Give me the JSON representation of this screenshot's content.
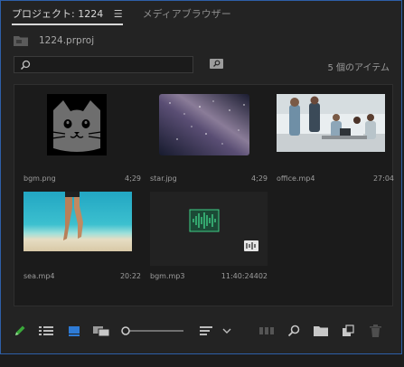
{
  "tabs": [
    {
      "label": "プロジェクト: 1224"
    },
    {
      "label": "メディアブラウザー"
    }
  ],
  "tab_menu_icon": "hamburger-menu-icon",
  "project": {
    "file_name": "1224.prproj",
    "icon": "project-folder-icon"
  },
  "search": {
    "value": "",
    "placeholder": ""
  },
  "item_count": "5 個のアイテム",
  "items": [
    {
      "name": "bgm.png",
      "duration": "4;29",
      "thumb": "cat-face-icon"
    },
    {
      "name": "star.jpg",
      "duration": "4;29",
      "thumb": "starry-sky-image"
    },
    {
      "name": "office.mp4",
      "duration": "27:04",
      "thumb": "office-meeting-image"
    },
    {
      "name": "sea.mp4",
      "duration": "20:22",
      "thumb": "beach-sea-image"
    },
    {
      "name": "bgm.mp3",
      "duration": "11:40:24402",
      "thumb": "audio-waveform-icon"
    }
  ],
  "colors": {
    "accent": "#2e5fa8",
    "panel_bg": "#232323",
    "grid_bg": "#1b1b1b",
    "pencil": "#3aa83a",
    "audio_thumb": "#3fcf86"
  },
  "toolbar_icons": [
    "pencil-icon",
    "list-view-icon",
    "icon-view-icon",
    "freeform-view-icon",
    "zoom-slider",
    "sort-icon",
    "automate-sequence-icon",
    "find-icon",
    "new-bin-icon",
    "new-item-icon",
    "trash-icon"
  ]
}
